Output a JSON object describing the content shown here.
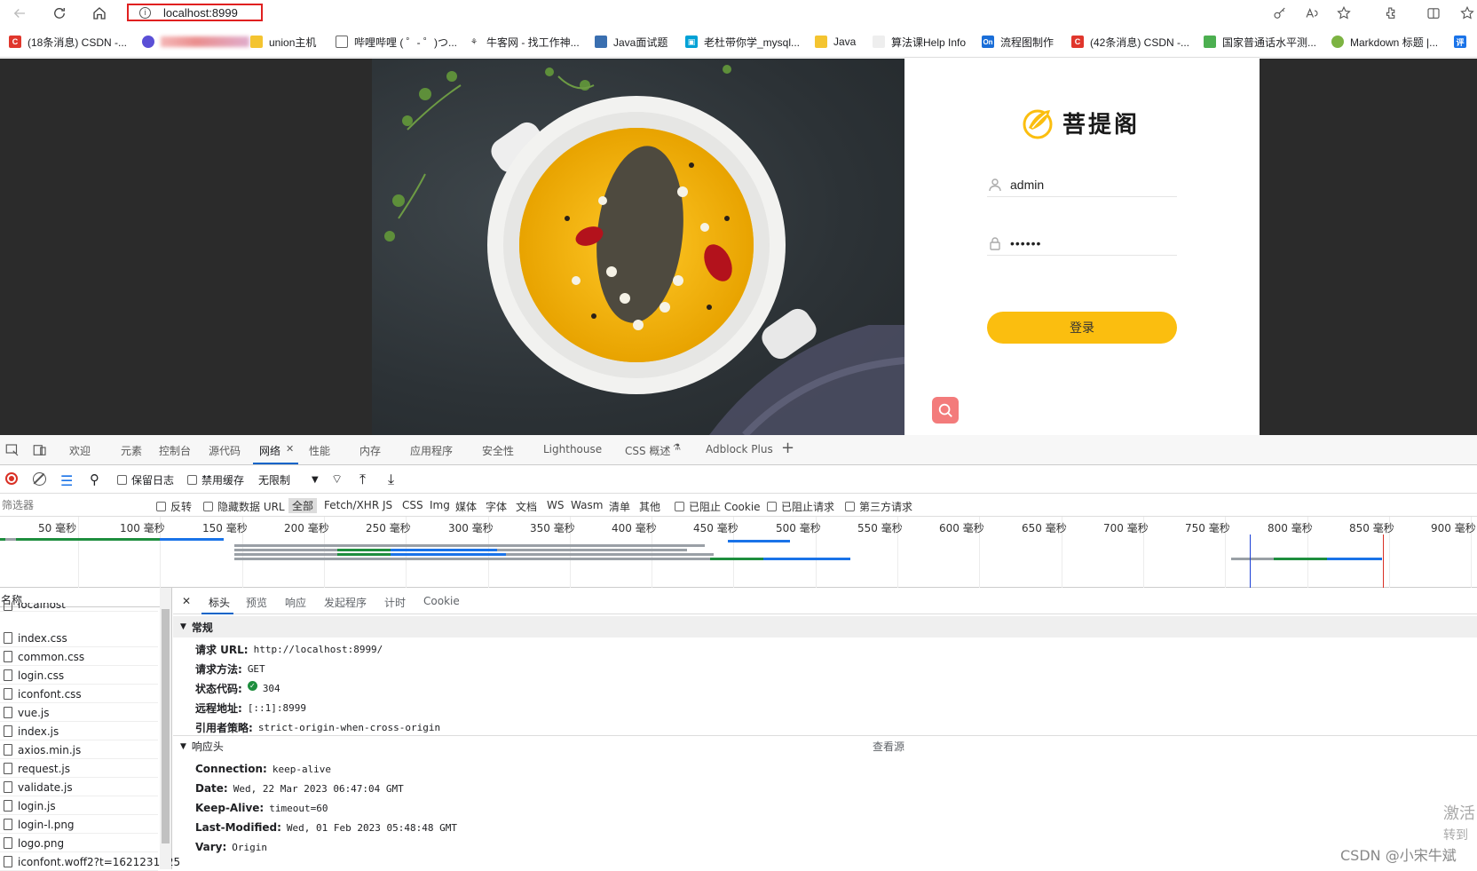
{
  "browser": {
    "url": "localhost:8999",
    "bookmarks": [
      {
        "label": "(18条消息) CSDN -...",
        "icon": "csdn-icon",
        "color": "#e0362c"
      },
      {
        "label": "",
        "icon": "blurred-site-icon",
        "color": "#5a4fd6"
      },
      {
        "label": "union主机",
        "icon": "folder-icon",
        "color": "#f4c430"
      },
      {
        "label": "哔哩哔哩 ( ゜- ゜)つ...",
        "icon": "page-icon",
        "color": "#888888"
      },
      {
        "label": "牛客网 - 找工作神...",
        "icon": "nowcoder-icon",
        "color": "#333333"
      },
      {
        "label": "Java面试题",
        "icon": "avatar-icon",
        "color": "#3a6fb0"
      },
      {
        "label": "老杜带你学_mysql...",
        "icon": "bilibili-icon",
        "color": "#00a1d6"
      },
      {
        "label": "Java",
        "icon": "folder-icon",
        "color": "#f4c430"
      },
      {
        "label": "算法课Help Info",
        "icon": "page-icon",
        "color": "#cccccc"
      },
      {
        "label": "流程图制作",
        "icon": "on-icon",
        "color": "#1a6ed8"
      },
      {
        "label": "(42条消息) CSDN -...",
        "icon": "csdn-icon",
        "color": "#e0362c"
      },
      {
        "label": "国家普通话水平测...",
        "icon": "db-icon",
        "color": "#4caf50"
      },
      {
        "label": "Markdown 标题 |...",
        "icon": "md-icon",
        "color": "#7cb342"
      },
      {
        "label": "评",
        "icon": "app-icon",
        "color": "#1a73e8"
      }
    ]
  },
  "login": {
    "brand": "菩提阁",
    "username": "admin",
    "password": "••••••",
    "submit_label": "登录"
  },
  "devtools": {
    "tabs": [
      "欢迎",
      "元素",
      "控制台",
      "源代码",
      "网络",
      "性能",
      "内存",
      "应用程序",
      "安全性",
      "Lighthouse",
      "CSS 概述",
      "Adblock Plus"
    ],
    "active_tab": "网络",
    "options": {
      "preserve_log": "保留日志",
      "disable_cache": "禁用缓存",
      "throttling": "无限制"
    },
    "filter": {
      "placeholder": "筛选器",
      "invert": "反转",
      "hide_data_urls": "隐藏数据 URL",
      "types": [
        "全部",
        "Fetch/XHR",
        "JS",
        "CSS",
        "Img",
        "媒体",
        "字体",
        "文档",
        "WS",
        "Wasm",
        "清单",
        "其他"
      ],
      "blocked_cookies": "已阻止 Cookie",
      "blocked_requests": "已阻止请求",
      "third_party": "第三方请求"
    },
    "timeline_unit": "毫秒",
    "timeline_ticks": [
      "50",
      "100",
      "150",
      "200",
      "250",
      "300",
      "350",
      "400",
      "450",
      "500",
      "550",
      "600",
      "650",
      "700",
      "750",
      "800",
      "850",
      "900"
    ],
    "name_header": "名称",
    "requests": [
      "localhost",
      "index.css",
      "common.css",
      "login.css",
      "iconfont.css",
      "vue.js",
      "index.js",
      "axios.min.js",
      "request.js",
      "validate.js",
      "login.js",
      "login-l.png",
      "logo.png",
      "iconfont.woff2?t=1621231825"
    ],
    "detail_tabs": [
      "标头",
      "预览",
      "响应",
      "发起程序",
      "计时",
      "Cookie"
    ],
    "general": {
      "title": "常规",
      "rows": [
        {
          "k": "请求 URL:",
          "v": "http://localhost:8999/"
        },
        {
          "k": "请求方法:",
          "v": "GET"
        },
        {
          "k": "状态代码:",
          "v": "304"
        },
        {
          "k": "远程地址:",
          "v": "[::1]:8999"
        },
        {
          "k": "引用者策略:",
          "v": "strict-origin-when-cross-origin"
        }
      ]
    },
    "response_headers": {
      "title": "响应头",
      "view_source": "查看源",
      "rows": [
        {
          "k": "Connection:",
          "v": "keep-alive"
        },
        {
          "k": "Date:",
          "v": "Wed, 22 Mar 2023 06:47:04 GMT"
        },
        {
          "k": "Keep-Alive:",
          "v": "timeout=60"
        },
        {
          "k": "Last-Modified:",
          "v": "Wed, 01 Feb 2023 05:48:48 GMT"
        },
        {
          "k": "Vary:",
          "v": "Origin"
        }
      ]
    }
  },
  "overlay": {
    "watermark": "CSDN @小宋牛斌",
    "activate_line1": "激活",
    "activate_line2": "转到"
  }
}
